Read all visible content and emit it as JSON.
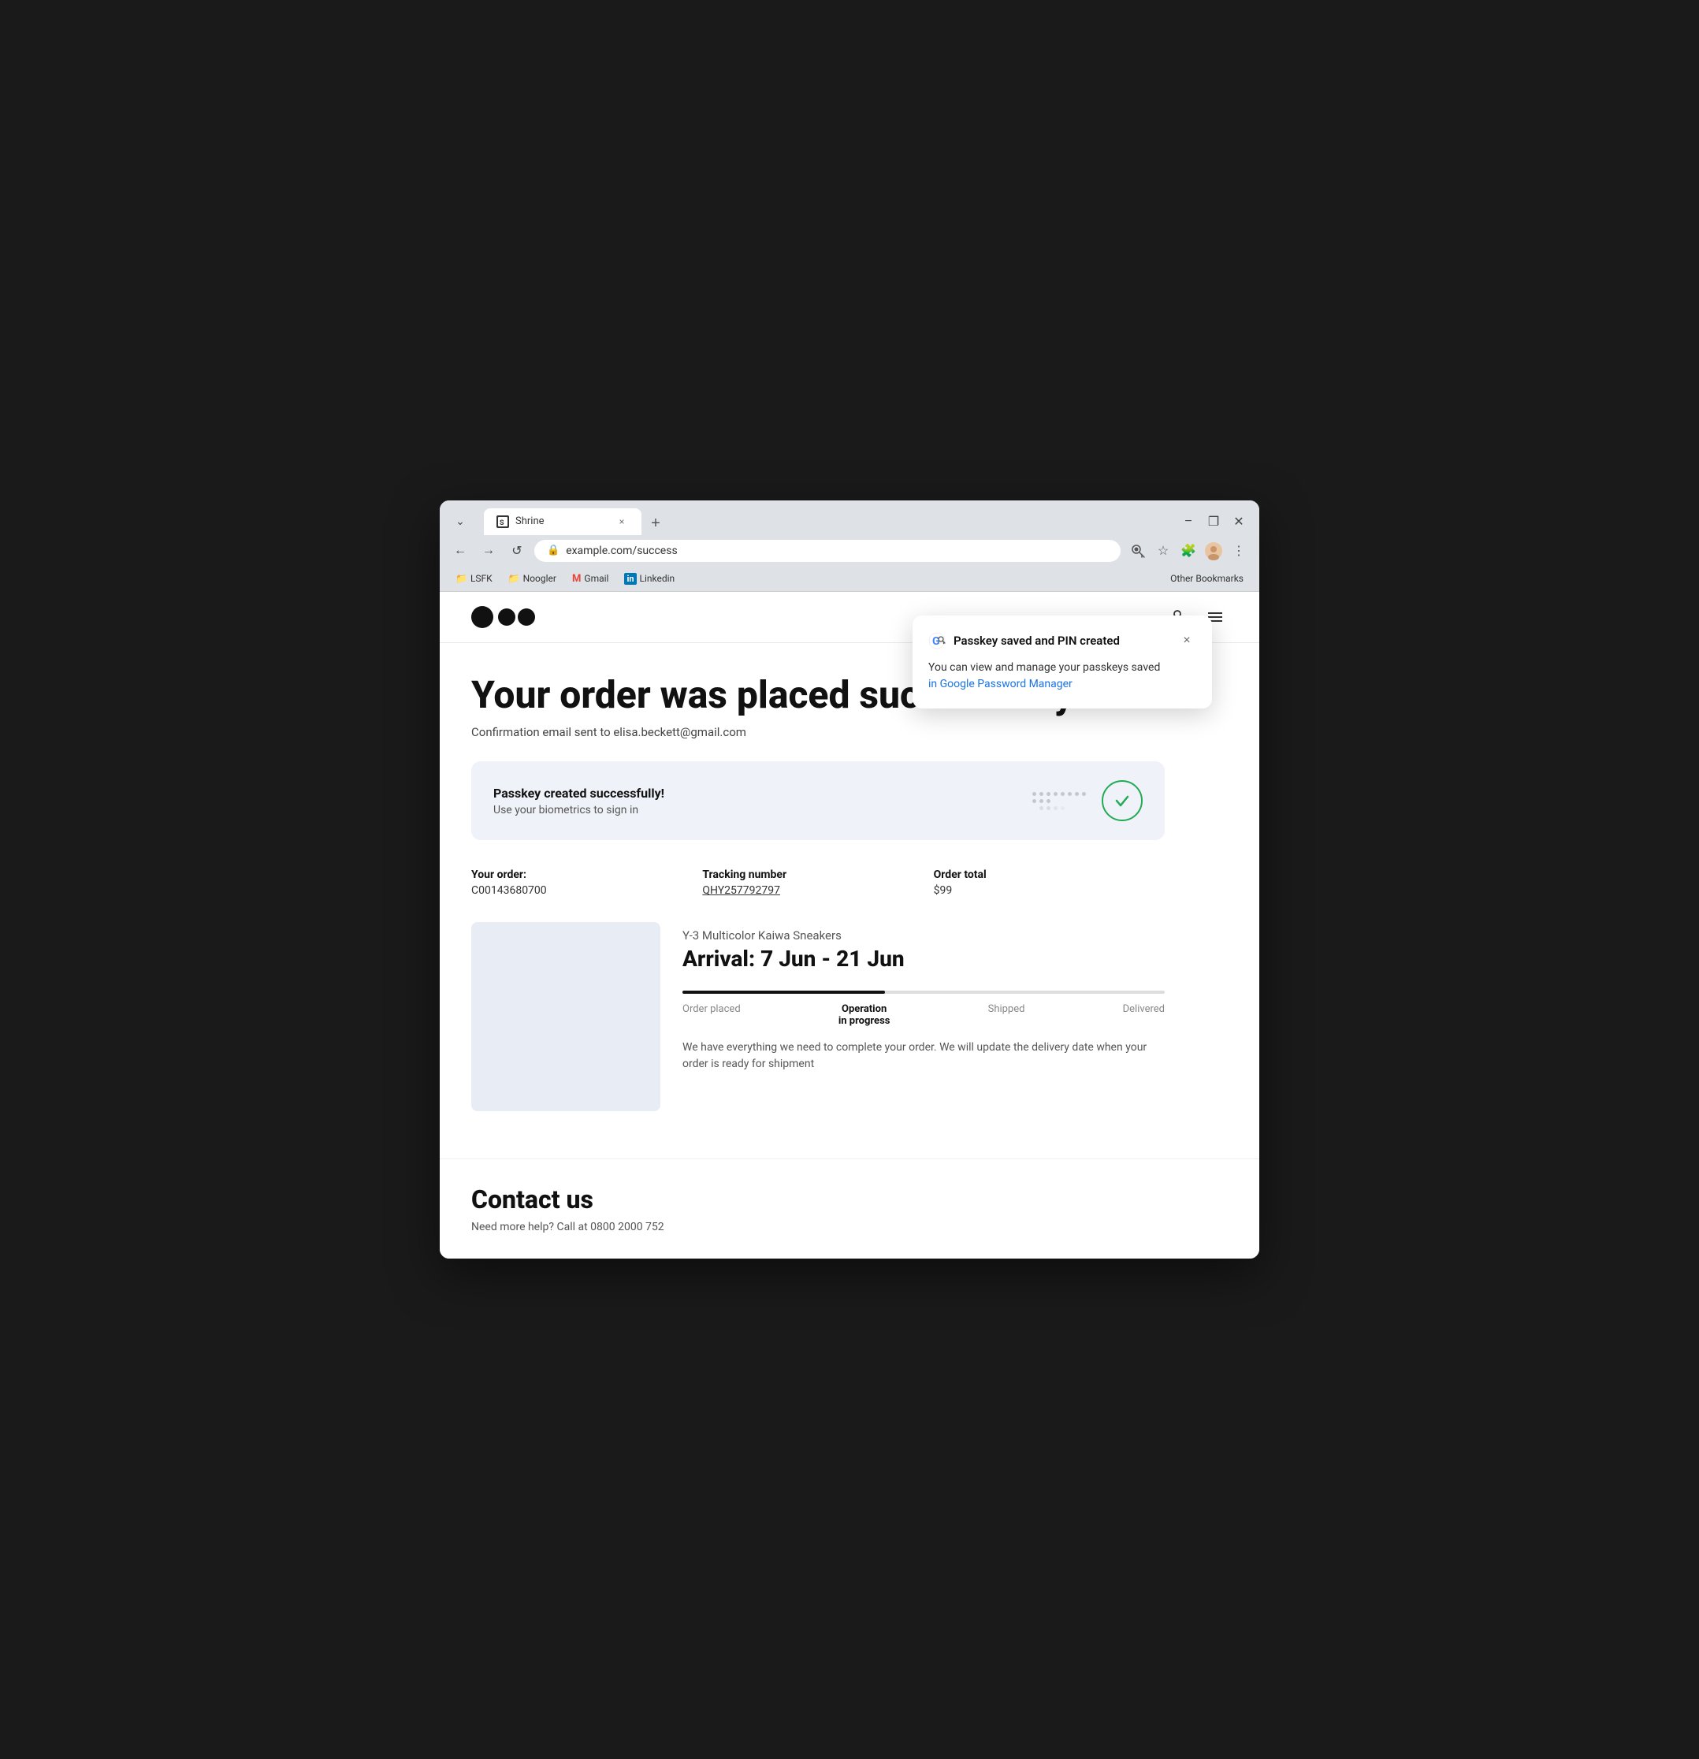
{
  "browser": {
    "tab_label": "Shrine",
    "url": "example.com/success",
    "close_label": "×",
    "new_tab_label": "+",
    "minimize_label": "−",
    "restore_label": "❐",
    "close_win_label": "✕",
    "back_label": "←",
    "forward_label": "→",
    "refresh_label": "↺",
    "menu_label": "⋮",
    "star_label": "☆",
    "extensions_label": "🧩",
    "profile_label": "👤"
  },
  "bookmarks": [
    {
      "label": "LSFK",
      "icon": "📁"
    },
    {
      "label": "Noogler",
      "icon": "📁"
    },
    {
      "label": "Gmail",
      "icon": "M"
    },
    {
      "label": "Linkedin",
      "icon": "in"
    },
    {
      "label": "Other Bookmarks"
    }
  ],
  "popup": {
    "title": "Passkey saved and PIN created",
    "body_text": "You can view and manage your passkeys saved",
    "link_text": "in Google Password Manager",
    "close_label": "×"
  },
  "page": {
    "site_name": "Shrine",
    "heading": "Your order was placed successfully",
    "confirmation": "Confirmation email sent to elisa.beckett@gmail.com",
    "passkey_banner": {
      "title": "Passkey created successfully!",
      "subtitle": "Use your biometrics to sign in"
    },
    "order": {
      "label": "Your order:",
      "number": "C00143680700",
      "tracking_label": "Tracking number",
      "tracking_number": "QHY257792797",
      "total_label": "Order total",
      "total_value": "$99"
    },
    "product": {
      "name": "Y-3 Multicolor Kaiwa Sneakers",
      "arrival": "Arrival: 7 Jun - 21 Jun"
    },
    "progress": {
      "fill_percent": 42,
      "steps": [
        {
          "label": "Order placed",
          "active": false
        },
        {
          "label": "Operation\nin progress",
          "active": true
        },
        {
          "label": "Shipped",
          "active": false
        },
        {
          "label": "Delivered",
          "active": false
        }
      ]
    },
    "order_description": "We have everything we need to complete your order. We will update the delivery date when your order is ready for shipment",
    "contact": {
      "title": "Contact us",
      "text": "Need more help? Call at 0800 2000 752"
    }
  },
  "colors": {
    "accent_green": "#22aa55",
    "link_blue": "#1a73e8",
    "logo_bg": "#111111",
    "banner_bg": "#f0f2f9",
    "product_img_bg": "#e8ecf5",
    "progress_fill": "#111111",
    "progress_track": "#dddddd"
  }
}
